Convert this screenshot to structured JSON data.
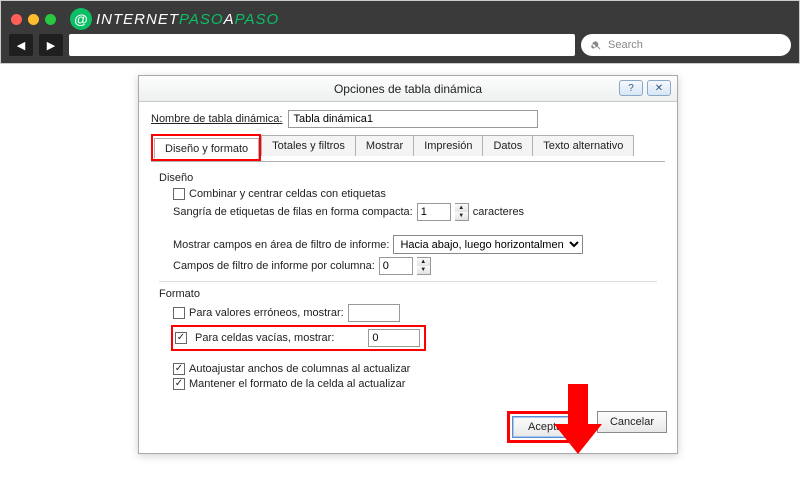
{
  "browser": {
    "logo_a": "INTERNET",
    "logo_b": "PASO",
    "logo_c": "A",
    "logo_d": "PASO",
    "search_placeholder": "Search"
  },
  "dialog": {
    "title": "Opciones de tabla dinámica",
    "name_label": "Nombre de tabla dinámica:",
    "name_value": "Tabla dinámica1",
    "tabs": {
      "design": "Diseño y formato",
      "totals": "Totales y filtros",
      "show": "Mostrar",
      "print": "Impresión",
      "data": "Datos",
      "alt": "Texto alternativo"
    },
    "design_group": "Diseño",
    "merge_label": "Combinar y centrar celdas con etiquetas",
    "indent_label": "Sangría de etiquetas de filas en forma compacta:",
    "indent_value": "1",
    "indent_suffix": "caracteres",
    "fields_label": "Mostrar campos en área de filtro de informe:",
    "fields_value": "Hacia abajo, luego horizontalmente",
    "perCol_label": "Campos de filtro de informe por columna:",
    "perCol_value": "0",
    "format_group": "Formato",
    "err_label": "Para valores erróneos, mostrar:",
    "err_value": "",
    "empty_label": "Para celdas vacías, mostrar:",
    "empty_value": "0",
    "autofit_label": "Autoajustar anchos de columnas al actualizar",
    "preserve_label": "Mantener el formato de la celda al actualizar",
    "accept": "Aceptar",
    "cancel": "Cancelar"
  }
}
